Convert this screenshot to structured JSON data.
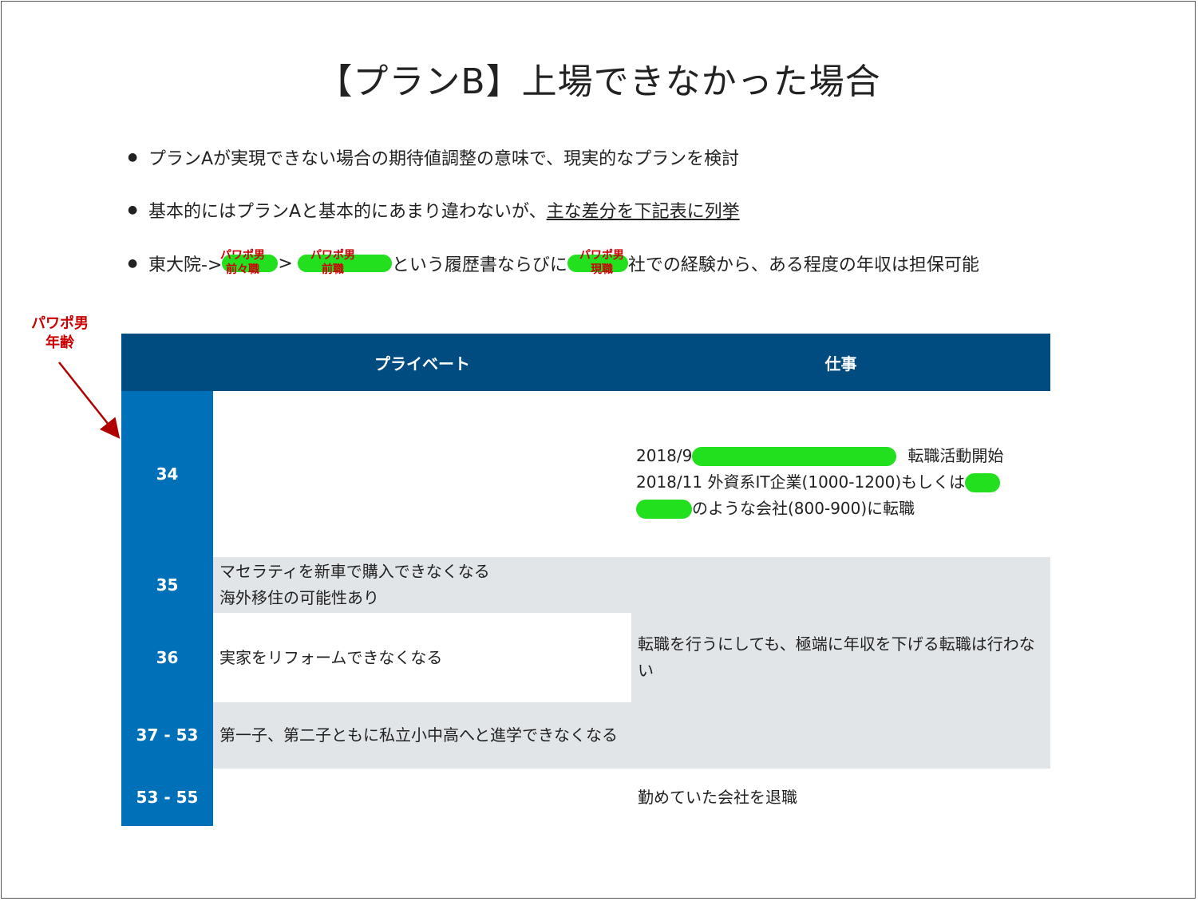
{
  "title": "【プランB】上場できなかった場合",
  "bullets": [
    {
      "text": "プランAが実現できない場合の期待値調整の意味で、現実的なプランを検討"
    },
    {
      "prefix": "基本的にはプランAと基本的にあまり違わないが、",
      "link": "主な差分を下記表に列挙"
    },
    {
      "part1": "東大院->",
      "part2": ">",
      "part3": "という履歴書ならびに",
      "part4": "社での経験から、ある程度の年収は担保可能"
    }
  ],
  "tags": {
    "t1": "パワポ男\n前々職",
    "t2": "パワポ男\n前職",
    "t3": "パワポ男\n現職"
  },
  "age_annotation": "パワポ男\n年齢",
  "table": {
    "headers": [
      "プライベート",
      "仕事"
    ],
    "rows": [
      {
        "age": "34",
        "private": "",
        "work_line1_a": "2018/9",
        "work_line1_b": "転職活動開始",
        "work_line2": "2018/11 外資系IT企業(1000-1200)もしくは",
        "work_line3": "のような会社(800-900)に転職"
      },
      {
        "age": "35",
        "private": "マセラティを新車で購入できなくなる\n海外移住の可能性あり"
      },
      {
        "age": "36",
        "private": "実家をリフォームできなくなる",
        "work": "転職を行うにしても、極端に年収を下げる転職は行わない"
      },
      {
        "age": "37 - 53",
        "private": "第一子、第二子ともに私立小中高へと進学できなくなる"
      },
      {
        "age": "53 - 55",
        "private": "",
        "work": "勤めていた会社を退職"
      }
    ]
  },
  "colors": {
    "header": "#004b80",
    "age_column": "#0070b8",
    "gray_row": "#e2e5e8",
    "redaction": "#22e01e",
    "annotation": "#cc0000"
  }
}
